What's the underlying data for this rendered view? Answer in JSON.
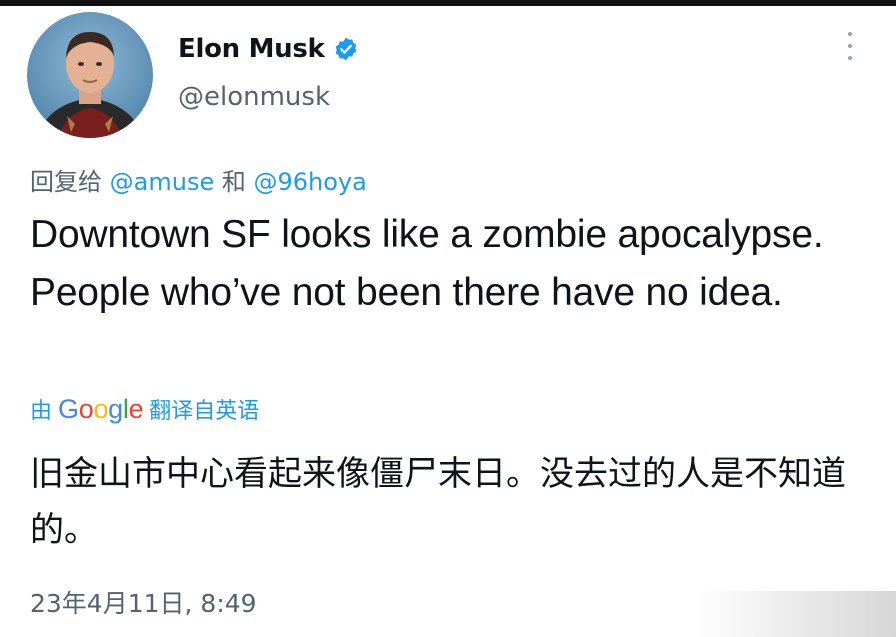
{
  "tweet": {
    "author": {
      "display_name": "Elon Musk",
      "handle": "@elonmusk",
      "verified_icon": "verified-badge-icon"
    },
    "reply": {
      "prefix": "回复给",
      "mention_1": "@amuse",
      "conjunction": "和",
      "mention_2": "@96hoya"
    },
    "text": "Downtown SF looks like a zombie apocalypse. People who’ve not been there have no idea.",
    "translation": {
      "by_label": "由",
      "provider": "Google",
      "action_label": "翻译自英语",
      "text": "旧金山市中心看起来像僵尸末日。没去过的人是不知道的。"
    },
    "timestamp": "23年4月11日, 8:49"
  },
  "colors": {
    "text_primary": "#0f1419",
    "text_secondary": "#536471",
    "accent": "#1d9bf0"
  }
}
